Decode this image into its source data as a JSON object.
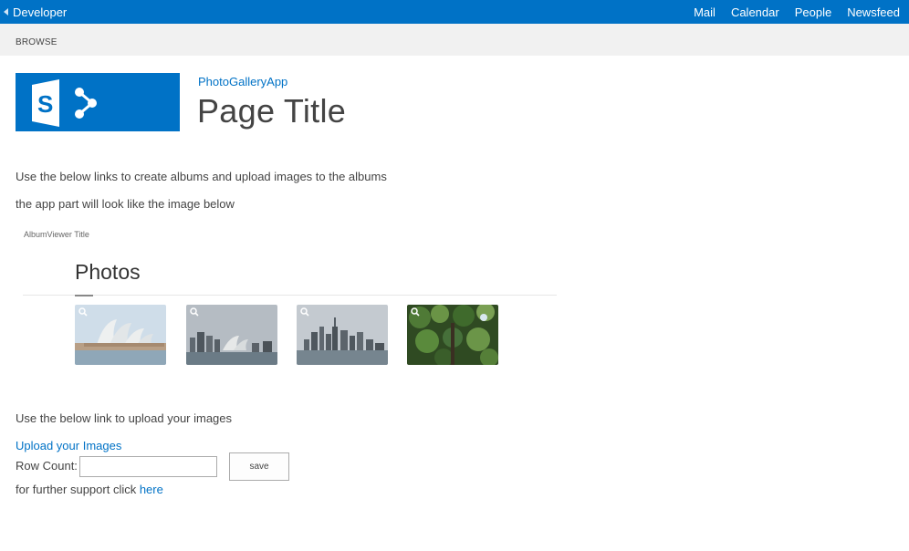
{
  "suitebar": {
    "back_label": "Developer",
    "links": [
      "Mail",
      "Calendar",
      "People",
      "Newsfeed"
    ],
    "accent_color": "#0072c6"
  },
  "ribbon": {
    "tab": "BROWSE"
  },
  "header": {
    "logo_icon": "sharepoint-logo-icon",
    "site_link": "PhotoGalleryApp",
    "page_title": "Page Title"
  },
  "content": {
    "intro_line_1": "Use the below links to create albums and upload images to the albums",
    "intro_line_2": "the app part will look like the image below",
    "app_part": {
      "title": "AlbumViewer Title",
      "heading": "Photos",
      "thumbnails": [
        {
          "subject": "opera-house-closeup"
        },
        {
          "subject": "opera-house-skyline"
        },
        {
          "subject": "city-skyline"
        },
        {
          "subject": "tree-foliage"
        }
      ],
      "zoom_icon": "magnifier-icon"
    },
    "upload_instruction": "Use the below link to upload your images",
    "upload_link": "Upload your Images",
    "row_count_label": "Row Count:",
    "row_count_value": "",
    "save_label": "save",
    "support_text": "for further support click ",
    "support_link": "here"
  }
}
